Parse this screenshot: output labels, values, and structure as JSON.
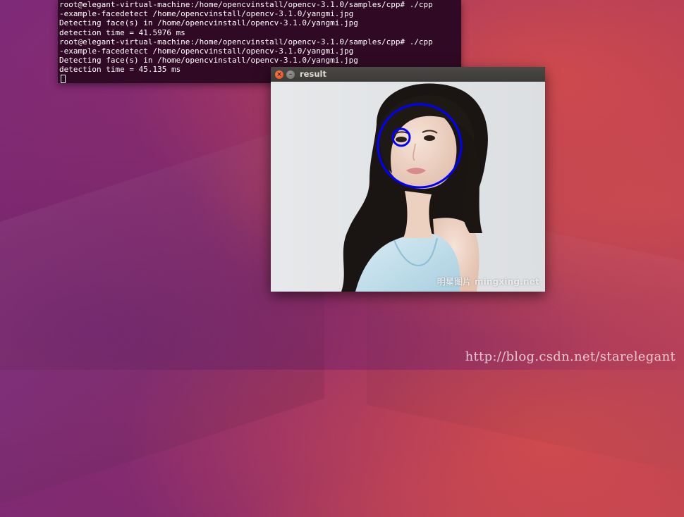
{
  "terminal": {
    "lines": [
      "root@elegant-virtual-machine:/home/opencvinstall/opencv-3.1.0/samples/cpp# ./cpp",
      "-example-facedetect /home/opencvinstall/opencv-3.1.0/yangmi.jpg",
      "Detecting face(s) in /home/opencvinstall/opencv-3.1.0/yangmi.jpg",
      "detection time = 41.5976 ms",
      "root@elegant-virtual-machine:/home/opencvinstall/opencv-3.1.0/samples/cpp# ./cpp",
      "-example-facedetect /home/opencvinstall/opencv-3.1.0/yangmi.jpg",
      "Detecting face(s) in /home/opencvinstall/opencv-3.1.0/yangmi.jpg",
      "detection time = 45.135 ms"
    ],
    "colors": {
      "background": "#300a24",
      "text": "#ffffff"
    }
  },
  "result_window": {
    "title": "result",
    "close_icon": "close-icon",
    "minimize_icon": "minimize-icon",
    "photo_watermark": "明星图片 mingxing.net",
    "detection_color": "#0000ff"
  },
  "desktop": {
    "watermark": "http://blog.csdn.net/starelegant",
    "colors": {
      "primary": "#8e2d6c",
      "accent": "#c0404f"
    }
  }
}
